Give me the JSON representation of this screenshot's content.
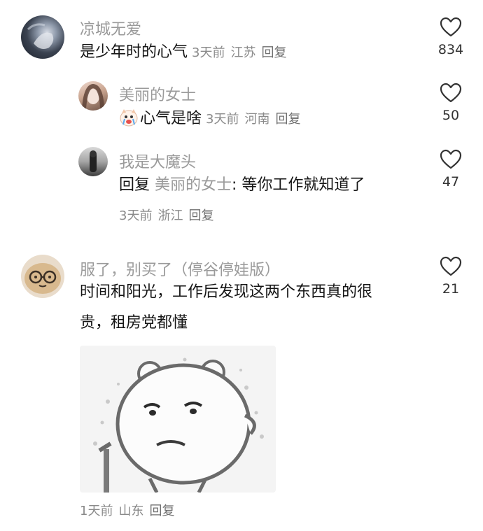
{
  "comments": [
    {
      "username": "凉城无爱",
      "text": "是少年时的心气",
      "time": "3天前",
      "location": "江苏",
      "reply_label": "回复",
      "likes": "834"
    },
    {
      "username": "美丽的女士",
      "text": "心气是啥",
      "time": "3天前",
      "location": "河南",
      "reply_label": "回复",
      "likes": "50",
      "emoji_icon": "crying-cat-emoji"
    },
    {
      "username": "我是大魔头",
      "reply_prefix": "回复",
      "reply_to": "美丽的女士",
      "text": ": 等你工作就知道了",
      "time": "3天前",
      "location": "浙江",
      "reply_label": "回复",
      "likes": "47"
    },
    {
      "username": "服了，别买了（停谷停娃版）",
      "text_line1": "时间和阳光，工作后发现这两个东西真的很",
      "text_line2": "贵，租房党都懂",
      "time": "1天前",
      "location": "山东",
      "reply_label": "回复",
      "likes": "21",
      "image": "grumpy-bear-meme"
    }
  ],
  "colors": {
    "username": "#9a9a9a",
    "text": "#161616",
    "meta": "#8a8a8a",
    "heart_outline": "#333333"
  }
}
